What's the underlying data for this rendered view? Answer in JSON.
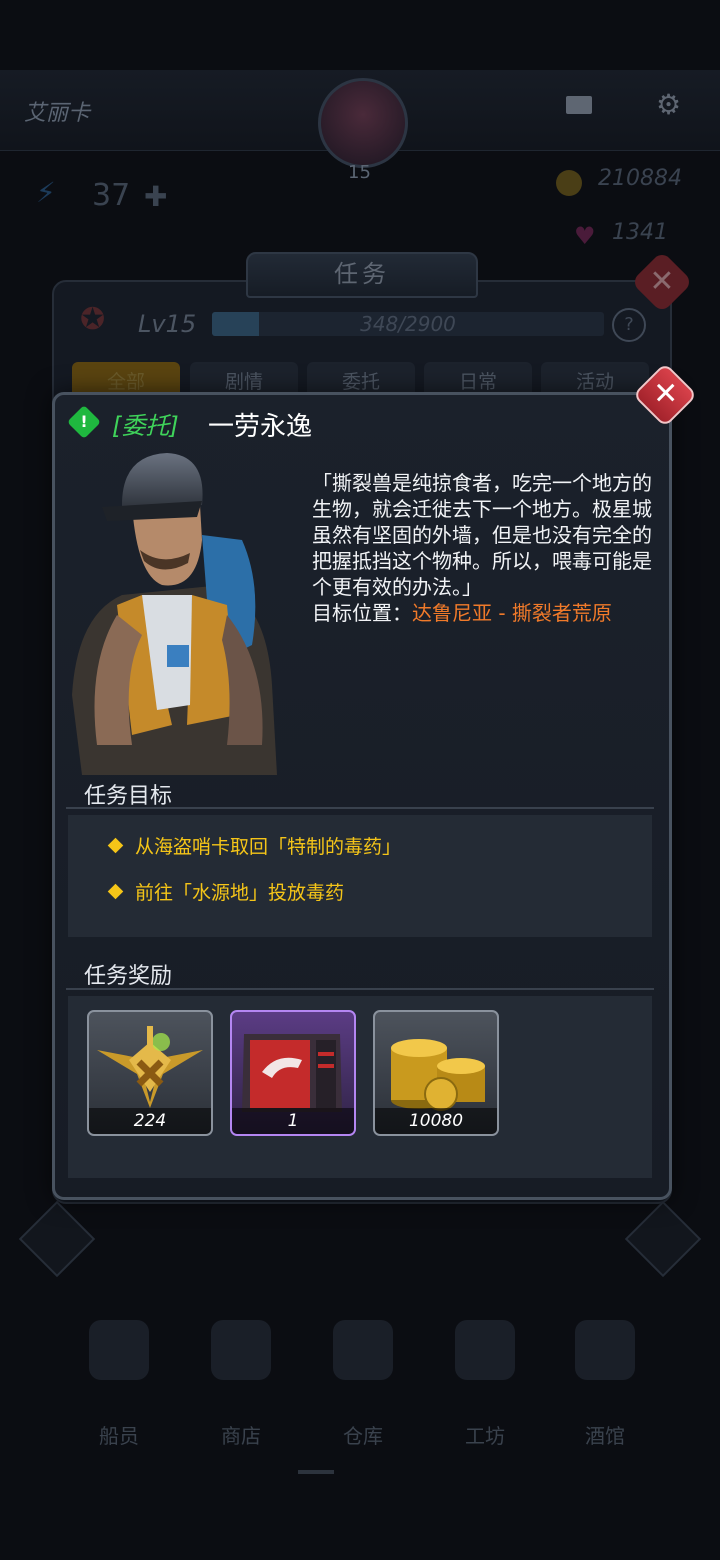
{
  "player": {
    "name": "艾丽卡",
    "avatar_level": "15"
  },
  "resources": {
    "energy": "37",
    "coins": "210884",
    "gems": "1341"
  },
  "quest_screen": {
    "title": "任务",
    "level_label": "Lv15",
    "xp_text": "348/2900",
    "xp_progress": 0.12,
    "tabs": [
      "全部",
      "剧情",
      "委托",
      "日常",
      "活动"
    ]
  },
  "bottom_nav": [
    "船员",
    "商店",
    "仓库",
    "工坊",
    "酒馆"
  ],
  "modal": {
    "category": "[委托]",
    "name": "一劳永逸",
    "description": "「撕裂兽是纯掠食者，吃完一个地方的生物，就会迁徙去下一个地方。极星城虽然有坚固的外墙，但是也没有完全的把握抵挡这个物种。所以，喂毒可能是个更有效的办法。」",
    "location_label": "目标位置：",
    "location_value": "达鲁尼亚 - 撕裂者荒原",
    "objectives_title": "任务目标",
    "objectives": [
      "从海盗哨卡取回「特制的毒药」",
      "前往「水源地」投放毒药"
    ],
    "rewards_title": "任务奖励",
    "rewards": [
      {
        "icon": "xp-medal-icon",
        "count": "224"
      },
      {
        "icon": "supply-crate-icon",
        "count": "1"
      },
      {
        "icon": "gold-coins-icon",
        "count": "10080"
      }
    ]
  },
  "colors": {
    "accent_green": "#3fd35a",
    "accent_orange": "#f07a2a",
    "objective_yellow": "#f5c518",
    "close_red": "#c8323b"
  }
}
